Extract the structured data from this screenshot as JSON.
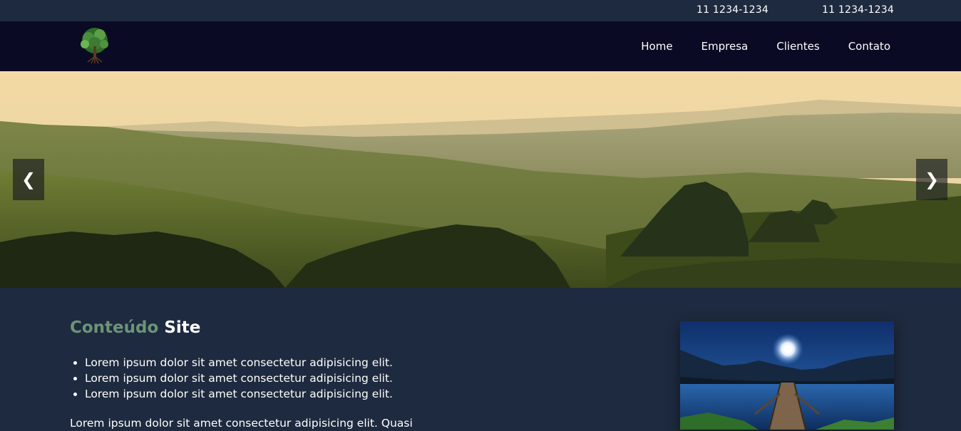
{
  "topbar": {
    "phone_1": "11 1234-1234",
    "phone_2": "11 1234-1234"
  },
  "header": {
    "logo_icon": "tree-logo-icon",
    "nav": [
      {
        "label": "Home"
      },
      {
        "label": "Empresa"
      },
      {
        "label": "Clientes"
      },
      {
        "label": "Contato"
      }
    ]
  },
  "carousel": {
    "prev_label": "❮",
    "next_label": "❯",
    "image": "rolling-hills-landscape"
  },
  "content": {
    "title_part_1": "Conteúdo",
    "title_part_2": "Site",
    "bullets": [
      "Lorem ipsum dolor sit amet consectetur adipisicing elit.",
      "Lorem ipsum dolor sit amet consectetur adipisicing elit.",
      "Lorem ipsum dolor sit amet consectetur adipisicing elit."
    ],
    "paragraph": "Lorem ipsum dolor sit amet consectetur adipisicing elit. Quasi",
    "side_image": "moonlit-lake-pier"
  },
  "colors": {
    "topbar_bg": "#1e2a3f",
    "navbar_bg": "#0a0a24",
    "title_accent": "#6c9478"
  }
}
